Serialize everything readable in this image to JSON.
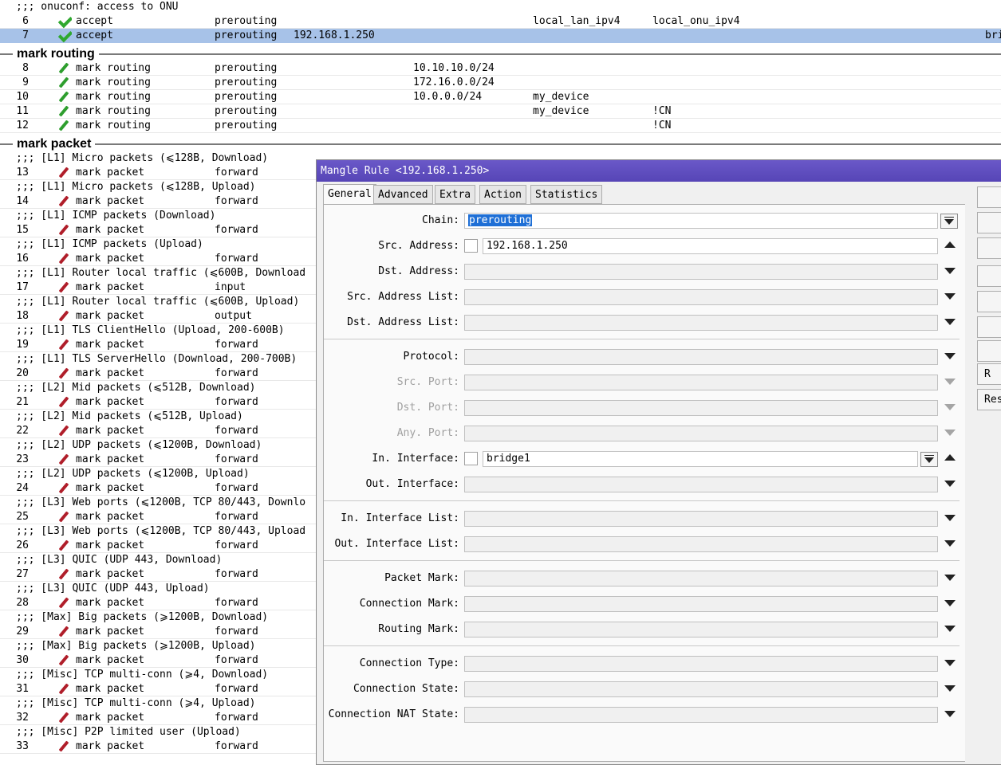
{
  "rows": [
    {
      "type": "comment",
      "text": ";;; onuconf: access to ONU",
      "top": 0
    },
    {
      "type": "rule",
      "num": "6",
      "icon": "check-icon",
      "action": "accept",
      "chain": "prerouting",
      "src": "",
      "dst": "",
      "src_list": "local_lan_ipv4",
      "dst_list": "local_onu_ipv4",
      "extra": ""
    },
    {
      "type": "rule",
      "num": "7",
      "icon": "check-icon",
      "action": "accept",
      "chain": "prerouting",
      "src": "192.168.1.250",
      "dst": "",
      "src_list": "",
      "dst_list": "",
      "extra": "bri",
      "selected": true
    }
  ],
  "section_routing": "mark routing",
  "routing_rows": [
    {
      "num": "8",
      "action": "mark routing",
      "chain": "prerouting",
      "src": "",
      "dst": "10.10.10.0/24",
      "src_list": "",
      "dst_list": ""
    },
    {
      "num": "9",
      "action": "mark routing",
      "chain": "prerouting",
      "src": "",
      "dst": "172.16.0.0/24",
      "src_list": "",
      "dst_list": ""
    },
    {
      "num": "10",
      "action": "mark routing",
      "chain": "prerouting",
      "src": "",
      "dst": "10.0.0.0/24",
      "src_list": "my_device",
      "dst_list": ""
    },
    {
      "num": "11",
      "action": "mark routing",
      "chain": "prerouting",
      "src": "",
      "dst": "",
      "src_list": "my_device",
      "dst_list": "!CN"
    },
    {
      "num": "12",
      "action": "mark routing",
      "chain": "prerouting",
      "src": "",
      "dst": "",
      "src_list": "",
      "dst_list": "!CN"
    }
  ],
  "section_packet": "mark packet",
  "packet_rows": [
    {
      "comment": ";;; [L1] Micro packets (⩽128B, Download)",
      "num": "13",
      "action": "mark packet",
      "chain": "forward"
    },
    {
      "comment": ";;; [L1] Micro packets (⩽128B, Upload)",
      "num": "14",
      "action": "mark packet",
      "chain": "forward"
    },
    {
      "comment": ";;; [L1] ICMP packets (Download)",
      "num": "15",
      "action": "mark packet",
      "chain": "forward"
    },
    {
      "comment": ";;; [L1] ICMP packets (Upload)",
      "num": "16",
      "action": "mark packet",
      "chain": "forward"
    },
    {
      "comment": ";;; [L1] Router local traffic (⩽600B, Download",
      "num": "17",
      "action": "mark packet",
      "chain": "input"
    },
    {
      "comment": ";;; [L1] Router local traffic (⩽600B, Upload)",
      "num": "18",
      "action": "mark packet",
      "chain": "output"
    },
    {
      "comment": ";;; [L1] TLS ClientHello (Upload, 200-600B)",
      "num": "19",
      "action": "mark packet",
      "chain": "forward"
    },
    {
      "comment": ";;; [L1] TLS ServerHello (Download, 200-700B)",
      "num": "20",
      "action": "mark packet",
      "chain": "forward"
    },
    {
      "comment": ";;; [L2] Mid packets (⩽512B, Download)",
      "num": "21",
      "action": "mark packet",
      "chain": "forward"
    },
    {
      "comment": ";;; [L2] Mid packets (⩽512B, Upload)",
      "num": "22",
      "action": "mark packet",
      "chain": "forward"
    },
    {
      "comment": ";;; [L2] UDP packets (⩽1200B, Download)",
      "num": "23",
      "action": "mark packet",
      "chain": "forward"
    },
    {
      "comment": ";;; [L2] UDP packets (⩽1200B, Upload)",
      "num": "24",
      "action": "mark packet",
      "chain": "forward"
    },
    {
      "comment": ";;; [L3] Web ports (⩽1200B, TCP 80/443, Downlo",
      "num": "25",
      "action": "mark packet",
      "chain": "forward"
    },
    {
      "comment": ";;; [L3] Web ports (⩽1200B, TCP 80/443, Upload",
      "num": "26",
      "action": "mark packet",
      "chain": "forward"
    },
    {
      "comment": ";;; [L3] QUIC (UDP 443, Download)",
      "num": "27",
      "action": "mark packet",
      "chain": "forward"
    },
    {
      "comment": ";;; [L3] QUIC (UDP 443, Upload)",
      "num": "28",
      "action": "mark packet",
      "chain": "forward"
    },
    {
      "comment": ";;; [Max] Big packets (⩾1200B, Download)",
      "num": "29",
      "action": "mark packet",
      "chain": "forward"
    },
    {
      "comment": ";;; [Max] Big packets (⩾1200B, Upload)",
      "num": "30",
      "action": "mark packet",
      "chain": "forward"
    },
    {
      "comment": ";;; [Misc] TCP multi-conn (⩾4, Download)",
      "num": "31",
      "action": "mark packet",
      "chain": "forward"
    },
    {
      "comment": ";;; [Misc] TCP multi-conn (⩾4, Upload)",
      "num": "32",
      "action": "mark packet",
      "chain": "forward"
    },
    {
      "comment": ";;; [Misc] P2P limited user (Upload)",
      "num": "33",
      "action": "mark packet",
      "chain": "forward"
    }
  ],
  "dialog": {
    "title": "Mangle Rule <192.168.1.250>",
    "tabs": [
      "General",
      "Advanced",
      "Extra",
      "Action",
      "Statistics"
    ],
    "active_tab": "General",
    "fields": {
      "chain": {
        "label": "Chain:",
        "value": "prerouting"
      },
      "src_address": {
        "label": "Src. Address:",
        "value": "192.168.1.250"
      },
      "dst_address": {
        "label": "Dst. Address:",
        "value": ""
      },
      "src_address_list": {
        "label": "Src. Address List:",
        "value": ""
      },
      "dst_address_list": {
        "label": "Dst. Address List:",
        "value": ""
      },
      "protocol": {
        "label": "Protocol:",
        "value": ""
      },
      "src_port": {
        "label": "Src. Port:",
        "value": ""
      },
      "dst_port": {
        "label": "Dst. Port:",
        "value": ""
      },
      "any_port": {
        "label": "Any. Port:",
        "value": ""
      },
      "in_interface": {
        "label": "In. Interface:",
        "value": "bridge1"
      },
      "out_interface": {
        "label": "Out. Interface:",
        "value": ""
      },
      "in_interface_list": {
        "label": "In. Interface List:",
        "value": ""
      },
      "out_interface_list": {
        "label": "Out. Interface List:",
        "value": ""
      },
      "packet_mark": {
        "label": "Packet Mark:",
        "value": ""
      },
      "connection_mark": {
        "label": "Connection Mark:",
        "value": ""
      },
      "routing_mark": {
        "label": "Routing Mark:",
        "value": ""
      },
      "connection_type": {
        "label": "Connection Type:",
        "value": ""
      },
      "connection_state": {
        "label": "Connection State:",
        "value": ""
      },
      "connection_nat_state": {
        "label": "Connection NAT State:",
        "value": ""
      }
    },
    "side_buttons": [
      "",
      "",
      "",
      "",
      "",
      "",
      "",
      "R",
      "Res"
    ]
  }
}
